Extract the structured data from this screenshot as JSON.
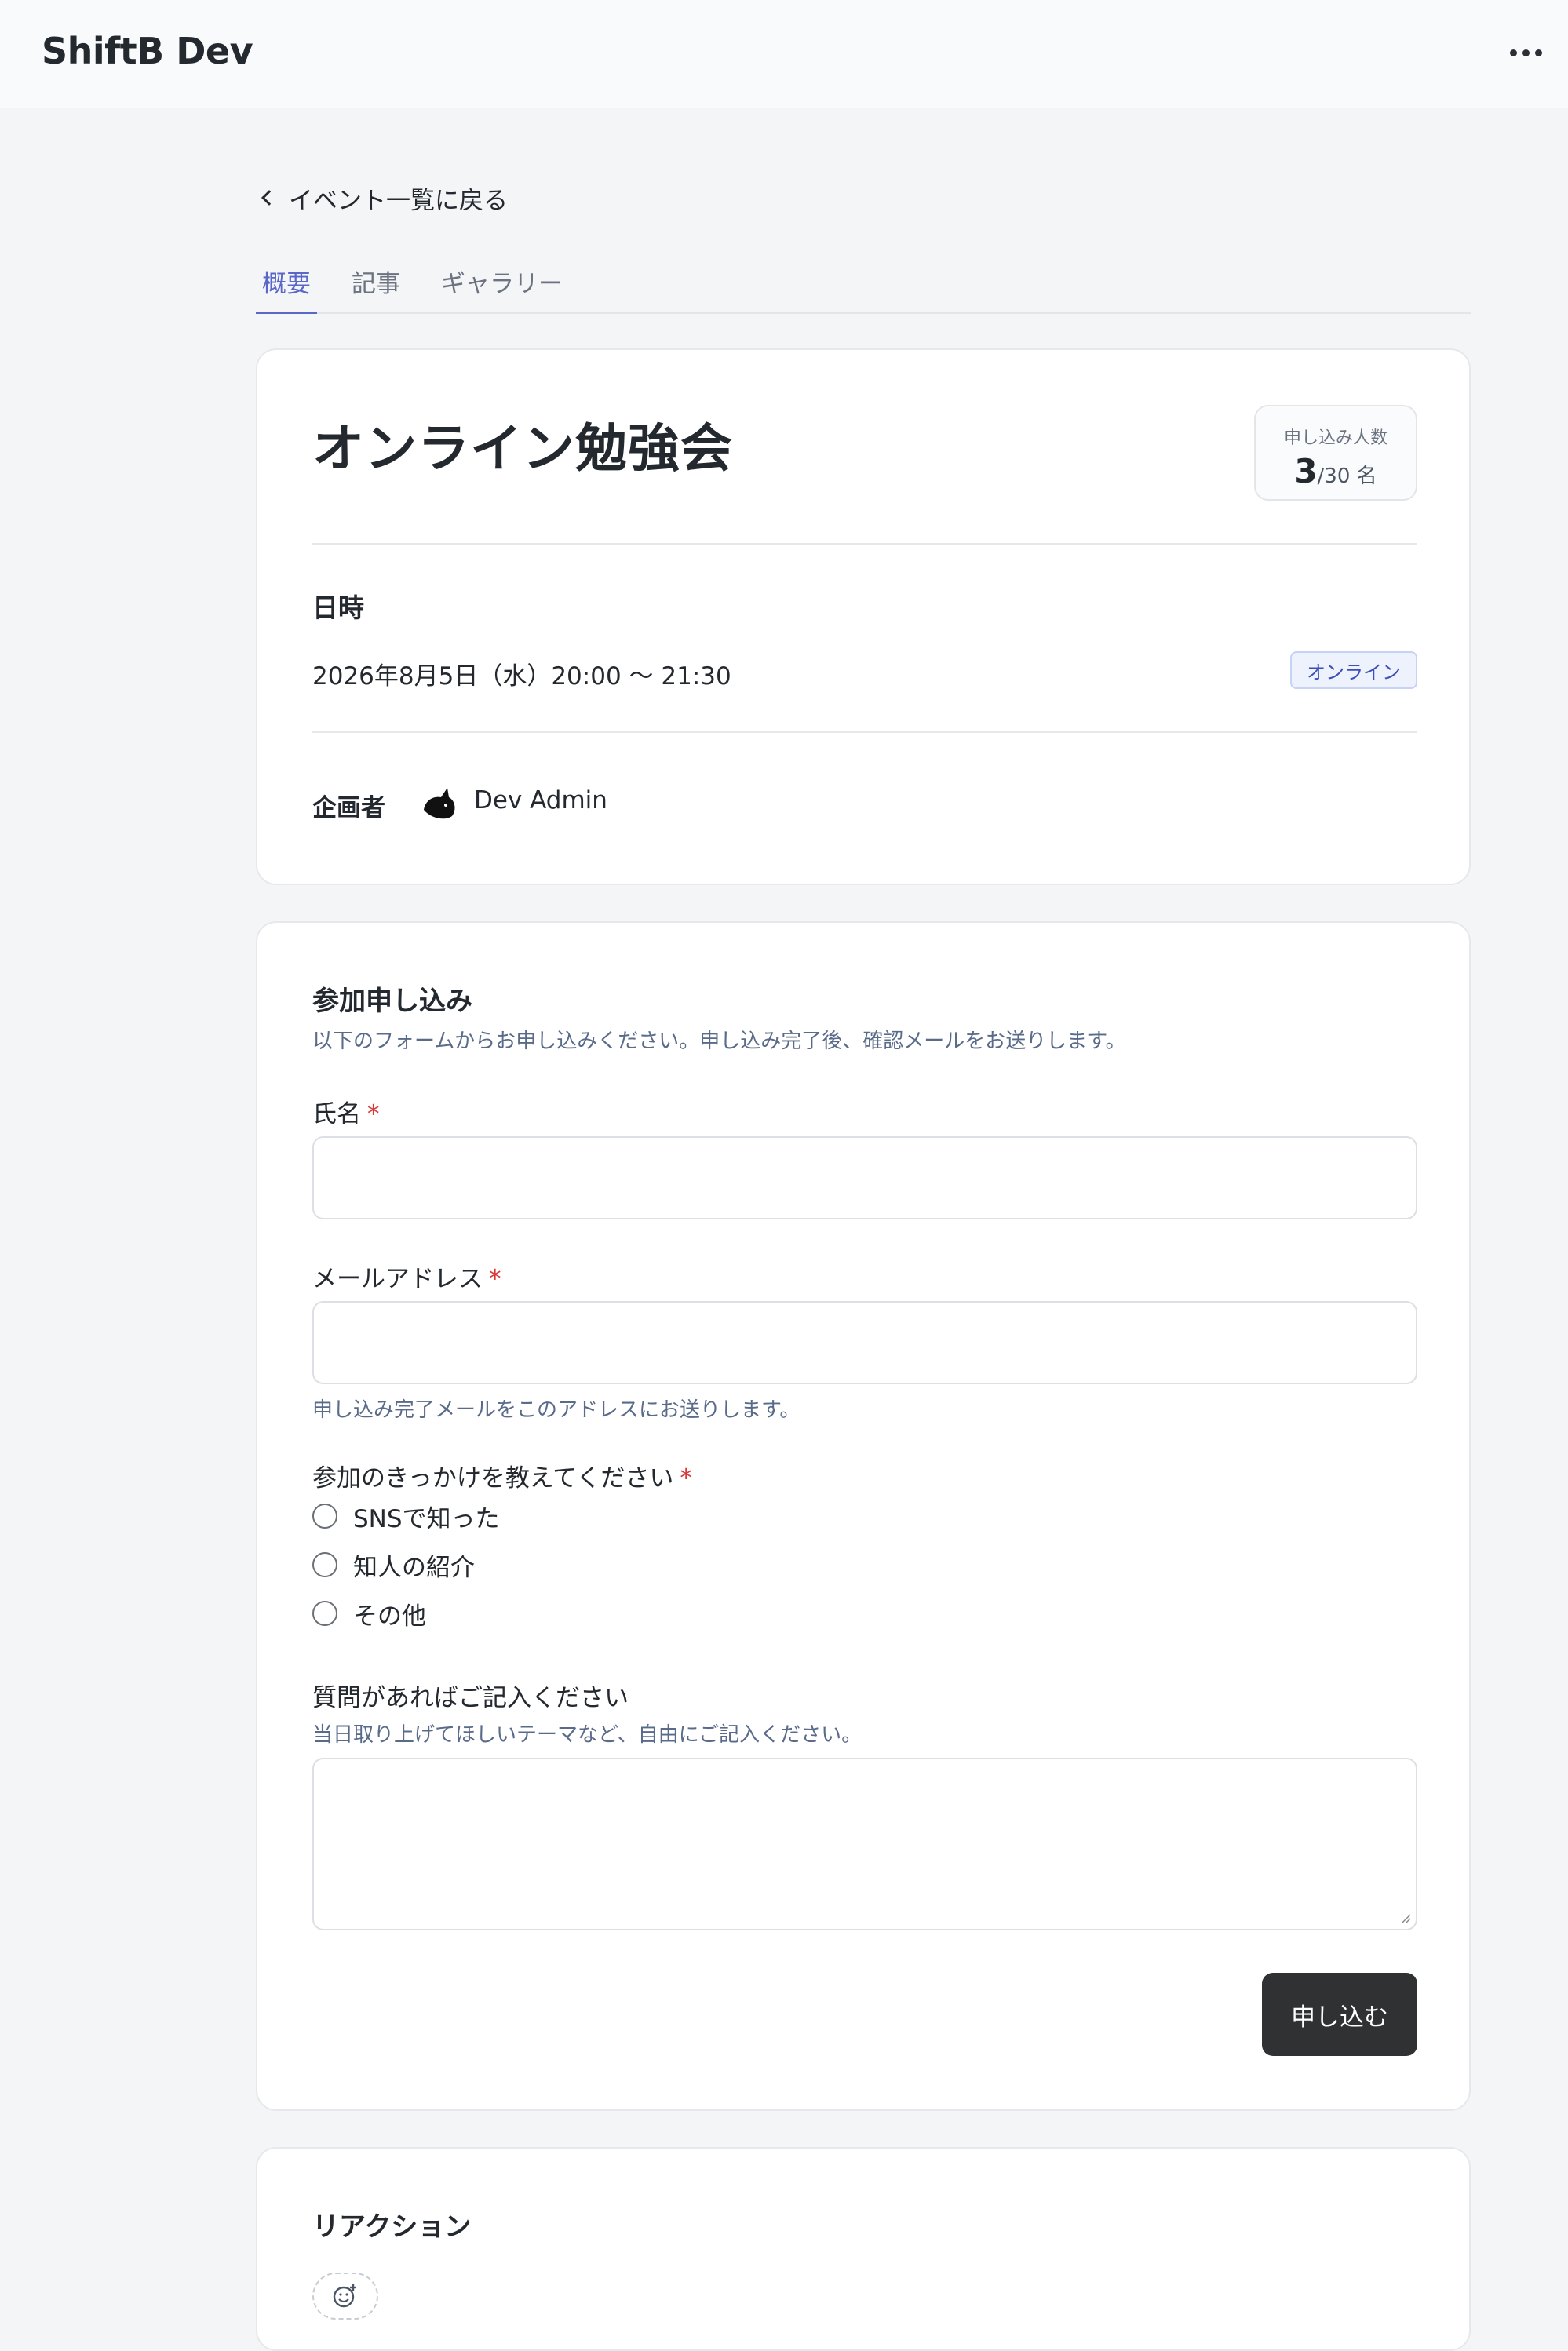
{
  "app": {
    "title": "ShiftB Dev"
  },
  "nav": {
    "back_label": "イベント一覧に戻る"
  },
  "tabs": [
    {
      "label": "概要",
      "active": true
    },
    {
      "label": "記事",
      "active": false
    },
    {
      "label": "ギャラリー",
      "active": false
    }
  ],
  "event": {
    "title": "オンライン勉強会",
    "capacity": {
      "label": "申し込み人数",
      "current": "3",
      "max": "/30",
      "unit": "名"
    },
    "datetime_heading": "日時",
    "datetime": "2026年8月5日（水）20:00 〜 21:30",
    "format_badge": "オンライン",
    "organizer_label": "企画者",
    "organizer_name": "Dev Admin"
  },
  "form": {
    "title": "参加申し込み",
    "description": "以下のフォームからお申し込みください。申し込み完了後、確認メールをお送りします。",
    "name_label": "氏名",
    "email_label": "メールアドレス",
    "email_hint": "申し込み完了メールをこのアドレスにお送りします。",
    "reason_label": "参加のきっかけを教えてください",
    "reason_options": [
      "SNSで知った",
      "知人の紹介",
      "その他"
    ],
    "question_label": "質問があればご記入ください",
    "question_hint": "当日取り上げてほしいテーマなど、自由にご記入ください。",
    "required_mark": "*",
    "submit_label": "申し込む"
  },
  "reactions": {
    "title": "リアクション",
    "add_icon": "add-reaction-icon"
  },
  "colors": {
    "accent": "#5a67c8",
    "required": "#d93636",
    "button": "#2f3133",
    "badge": "#3b4fb8"
  }
}
